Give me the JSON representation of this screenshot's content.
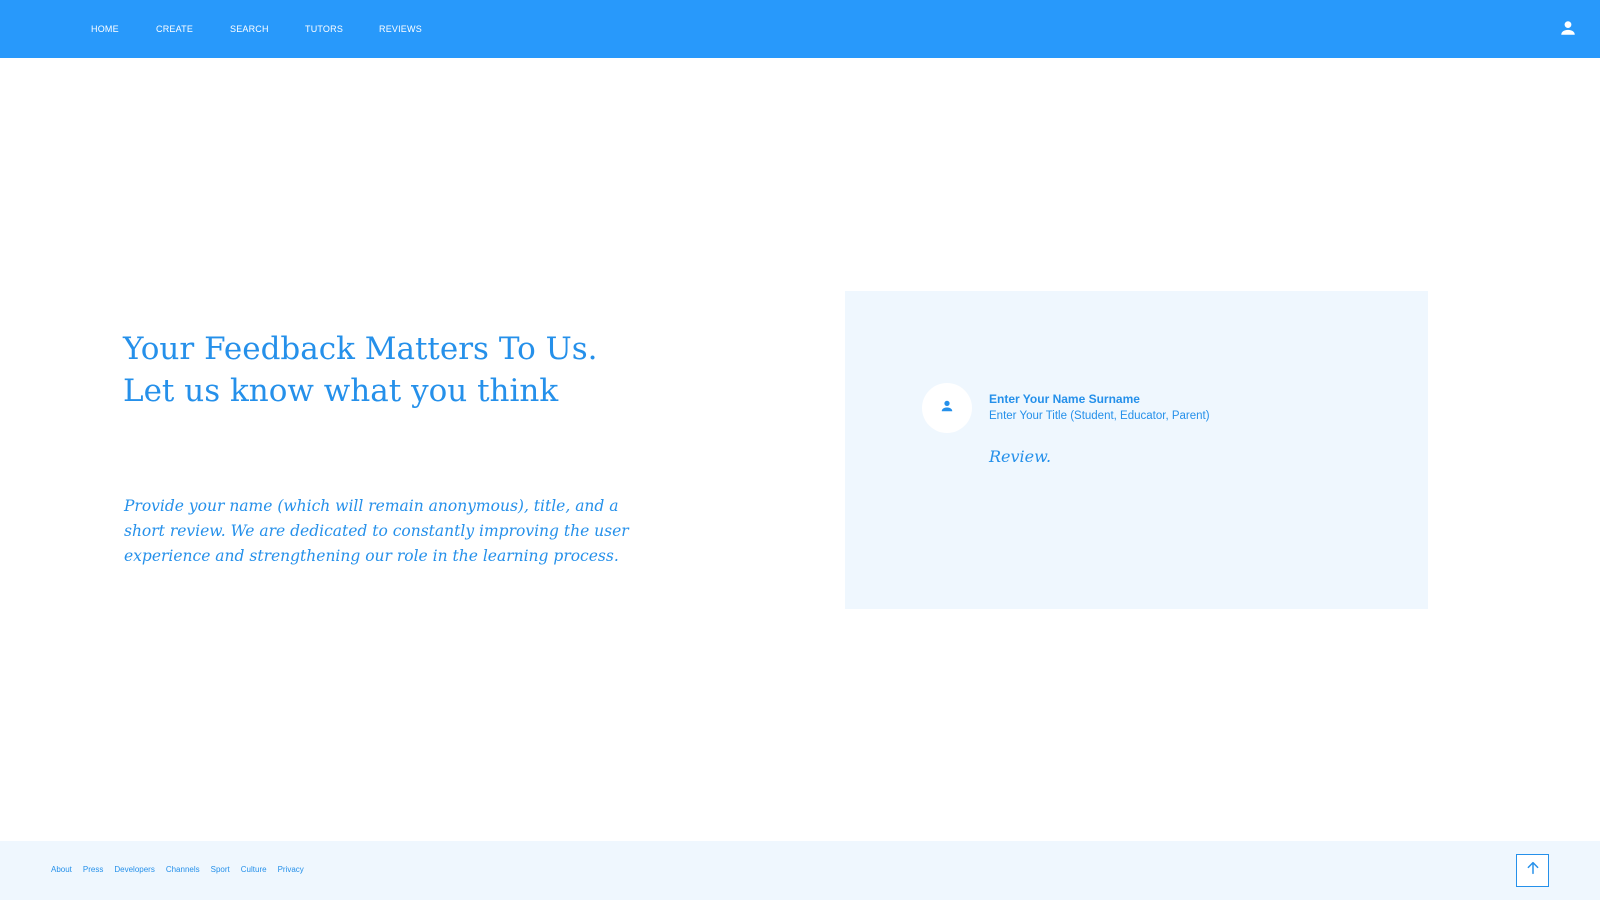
{
  "nav": {
    "items": [
      "HOME",
      "CREATE",
      "SEARCH",
      "TUTORS",
      "REVIEWS"
    ],
    "user_icon": "user-icon"
  },
  "hero": {
    "title_line1": "Your Feedback Matters To Us.",
    "title_line2": "Let us know what you think",
    "description": "Provide your name (which will remain anonymous), title, and a short review. We are dedicated to constantly improving the user experience and strengthening our role in the learning process."
  },
  "review_card": {
    "name_placeholder": "Enter Your Name Surname",
    "title_placeholder": "Enter Your Title (Student, Educator, Parent)",
    "review_placeholder": "Review.",
    "avatar_icon": "user-icon"
  },
  "footer": {
    "links": [
      "About",
      "Press",
      "Developers",
      "Channels",
      "Sport",
      "Culture",
      "Privacy"
    ],
    "scroll_top_icon": "arrow-up-icon"
  },
  "colors": {
    "primary": "#2899fb",
    "text_blue": "#2590ea",
    "panel_bg": "#eff7fe"
  }
}
